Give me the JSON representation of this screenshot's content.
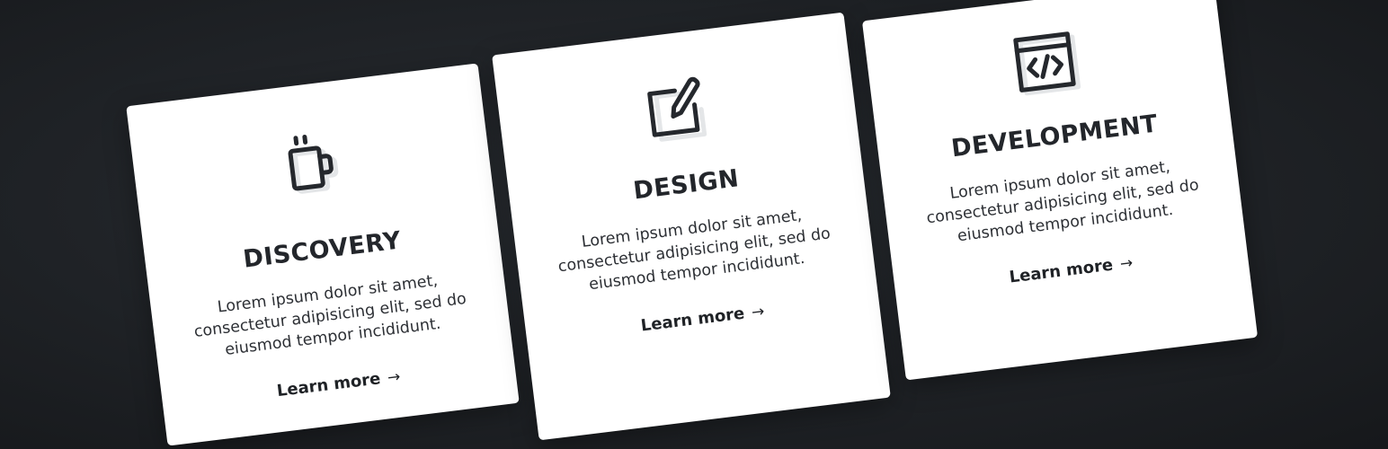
{
  "cards": [
    {
      "id": "discovery",
      "icon": "mug-icon",
      "title": "DISCOVERY",
      "description": "Lorem ipsum dolor sit amet, consectetur adipisicing elit, sed do eiusmod tempor incididunt.",
      "link_label": "Learn more",
      "link_arrow": "→"
    },
    {
      "id": "design",
      "icon": "pencil-square-icon",
      "title": "DESIGN",
      "description": "Lorem ipsum dolor sit amet, consectetur adipisicing elit, sed do eiusmod tempor incididunt.",
      "link_label": "Learn more",
      "link_arrow": "→"
    },
    {
      "id": "development",
      "icon": "code-window-icon",
      "title": "DEVELOPMENT",
      "description": "Lorem ipsum dolor sit amet, consectetur adipisicing elit, sed do eiusmod tempor incididunt.",
      "link_label": "Learn more",
      "link_arrow": "→"
    }
  ],
  "colors": {
    "background": "#1f2226",
    "card": "#ffffff",
    "text": "#23262b",
    "icon_shadow": "#e4e6e8"
  }
}
